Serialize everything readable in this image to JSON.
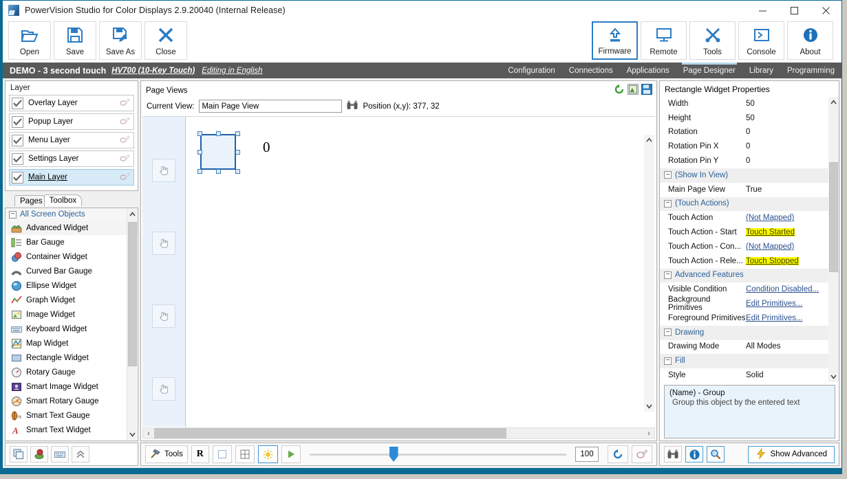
{
  "window": {
    "title": "PowerVision Studio for Color Displays 2.9.20040 (Internal Release)",
    "minimize": "minimize-icon",
    "maximize": "maximize-icon",
    "close": "close-icon"
  },
  "ribbon": {
    "left_buttons": [
      {
        "label": "Open",
        "icon": "folder-open-icon"
      },
      {
        "label": "Save",
        "icon": "floppy-disk-icon"
      },
      {
        "label": "Save As",
        "icon": "floppy-disk-pencil-icon"
      },
      {
        "label": "Close",
        "icon": "x-icon"
      }
    ],
    "right_buttons": [
      {
        "label": "Firmware",
        "icon": "upload-chip-icon",
        "selected": true
      },
      {
        "label": "Remote",
        "icon": "monitor-icon",
        "selected": false
      },
      {
        "label": "Tools",
        "icon": "wrench-screwdriver-icon",
        "selected": false
      },
      {
        "label": "Console",
        "icon": "terminal-icon",
        "selected": false
      },
      {
        "label": "About",
        "icon": "info-circle-icon",
        "selected": false
      }
    ]
  },
  "menustrip": {
    "project_name": "DEMO - 3 second touch",
    "device_link": "HV700 (10-Key Touch)",
    "language_link": "Editing in English",
    "items": [
      {
        "label": "Configuration",
        "active": false
      },
      {
        "label": "Connections",
        "active": false
      },
      {
        "label": "Applications",
        "active": false
      },
      {
        "label": "Page Designer",
        "active": true
      },
      {
        "label": "Library",
        "active": false
      },
      {
        "label": "Programming",
        "active": false
      }
    ]
  },
  "layer_panel": {
    "caption": "Layer",
    "layers": [
      {
        "name": "Overlay Layer",
        "checked": true,
        "selected": false
      },
      {
        "name": "Popup Layer",
        "checked": true,
        "selected": false
      },
      {
        "name": "Menu Layer",
        "checked": true,
        "selected": false
      },
      {
        "name": "Settings Layer",
        "checked": true,
        "selected": false
      },
      {
        "name": "Main Layer",
        "checked": true,
        "selected": true
      }
    ]
  },
  "left_tabs": [
    {
      "label": "Pages",
      "active": false
    },
    {
      "label": "Toolbox",
      "active": true
    }
  ],
  "toolbox": {
    "group_label": "All Screen Objects",
    "items": [
      {
        "label": "Advanced Widget",
        "icon": "advanced-widget-icon"
      },
      {
        "label": "Bar Gauge",
        "icon": "bar-gauge-icon"
      },
      {
        "label": "Container Widget",
        "icon": "container-widget-icon"
      },
      {
        "label": "Curved Bar Gauge",
        "icon": "curved-bar-gauge-icon"
      },
      {
        "label": "Ellipse Widget",
        "icon": "ellipse-widget-icon"
      },
      {
        "label": "Graph Widget",
        "icon": "graph-widget-icon"
      },
      {
        "label": "Image Widget",
        "icon": "image-widget-icon"
      },
      {
        "label": "Keyboard Widget",
        "icon": "keyboard-widget-icon"
      },
      {
        "label": "Map Widget",
        "icon": "map-widget-icon"
      },
      {
        "label": "Rectangle Widget",
        "icon": "rectangle-widget-icon"
      },
      {
        "label": "Rotary Gauge",
        "icon": "rotary-gauge-icon"
      },
      {
        "label": "Smart Image Widget",
        "icon": "smart-image-widget-icon"
      },
      {
        "label": "Smart Rotary Gauge",
        "icon": "smart-rotary-gauge-icon"
      },
      {
        "label": "Smart Text Gauge",
        "icon": "smart-text-gauge-icon"
      },
      {
        "label": "Smart Text Widget",
        "icon": "smart-text-widget-icon"
      }
    ],
    "bottom_buttons": [
      {
        "icon": "copy-pages-icon"
      },
      {
        "icon": "database-objects-icon"
      },
      {
        "icon": "keyboard-icon"
      },
      {
        "icon": "collapse-up-icon"
      }
    ]
  },
  "page_views": {
    "caption": "Page Views",
    "header_icons": [
      {
        "icon": "refresh-green-icon"
      },
      {
        "icon": "export-image-icon"
      },
      {
        "icon": "save-view-icon"
      }
    ],
    "current_view_label": "Current View:",
    "current_view_value": "Main Page View",
    "current_view_placeholder": "Main Page View",
    "binoculars_icon": "binoculars-icon",
    "position_text": "Position (x,y): 377, 32",
    "canvas": {
      "hand_buttons": 4,
      "hand_icon": "pointing-hand-icon",
      "selected_widget": "rectangle-widget-selection",
      "text_value": "0"
    }
  },
  "bottom_toolbar": {
    "tools_label": "Tools",
    "tools_icon": "tools-hammer-icon",
    "buttons": [
      {
        "label": "R",
        "icon": "ruler-r-icon",
        "selected": false
      },
      {
        "label": "",
        "icon": "blank-page-icon",
        "selected": false
      },
      {
        "label": "",
        "icon": "grid-icon",
        "selected": false
      },
      {
        "label": "",
        "icon": "brightness-sun-icon",
        "selected": true
      },
      {
        "label": "",
        "icon": "play-icon",
        "selected": false
      }
    ],
    "zoom_value": "100",
    "right_buttons": [
      {
        "icon": "refresh-blue-icon"
      },
      {
        "icon": "eyedropper-icon"
      }
    ]
  },
  "properties": {
    "caption": "Rectangle Widget Properties",
    "rows": [
      {
        "kind": "prop",
        "key": "Width",
        "value": "50",
        "style": "plain"
      },
      {
        "kind": "prop",
        "key": "Height",
        "value": "50",
        "style": "plain"
      },
      {
        "kind": "prop",
        "key": "Rotation",
        "value": "0",
        "style": "plain"
      },
      {
        "kind": "prop",
        "key": "Rotation Pin X",
        "value": "0",
        "style": "plain"
      },
      {
        "kind": "prop",
        "key": "Rotation Pin Y",
        "value": "0",
        "style": "plain"
      },
      {
        "kind": "cat",
        "key": "(Show In View)",
        "value": "",
        "style": "plain"
      },
      {
        "kind": "prop",
        "key": "Main Page View",
        "value": "True",
        "style": "plain"
      },
      {
        "kind": "cat",
        "key": "(Touch Actions)",
        "value": "",
        "style": "plain"
      },
      {
        "kind": "prop",
        "key": "Touch Action",
        "value": "(Not Mapped)",
        "style": "link"
      },
      {
        "kind": "prop",
        "key": "Touch Action - Start",
        "value": "Touch Started",
        "style": "highlight"
      },
      {
        "kind": "prop",
        "key": "Touch Action - Con...",
        "value": "(Not Mapped)",
        "style": "link"
      },
      {
        "kind": "prop",
        "key": "Touch Action - Rele...",
        "value": "Touch Stopped",
        "style": "highlight"
      },
      {
        "kind": "cat",
        "key": "Advanced Features",
        "value": "",
        "style": "plain"
      },
      {
        "kind": "prop",
        "key": "Visible Condition",
        "value": "Condition Disabled...",
        "style": "link"
      },
      {
        "kind": "prop",
        "key": "Background Primitives",
        "value": "Edit Primitives...",
        "style": "link"
      },
      {
        "kind": "prop",
        "key": "Foreground Primitives",
        "value": "Edit Primitives...",
        "style": "link"
      },
      {
        "kind": "cat",
        "key": "Drawing",
        "value": "",
        "style": "plain"
      },
      {
        "kind": "prop",
        "key": "Drawing Mode",
        "value": "All Modes",
        "style": "plain"
      },
      {
        "kind": "cat",
        "key": "Fill",
        "value": "",
        "style": "plain"
      },
      {
        "kind": "prop",
        "key": "Style",
        "value": "Solid",
        "style": "plain"
      }
    ],
    "description": {
      "title": "(Name) - Group",
      "detail": "Group this object by the entered text"
    },
    "footer_buttons": [
      {
        "icon": "binoculars-icon",
        "selected": false
      },
      {
        "icon": "info-circle-icon",
        "selected": true
      },
      {
        "icon": "magnifier-icon",
        "selected": true
      }
    ],
    "show_advanced_label": "Show Advanced",
    "show_advanced_icon": "lightning-bolt-icon"
  },
  "colors": {
    "accent": "#0a6a94",
    "menu_bg": "#595959",
    "selection_blue": "#2b7cc4",
    "highlight_yellow": "#ffff00",
    "link_blue": "#2b4f8e",
    "canvas_bg": "#eaf3fb"
  }
}
